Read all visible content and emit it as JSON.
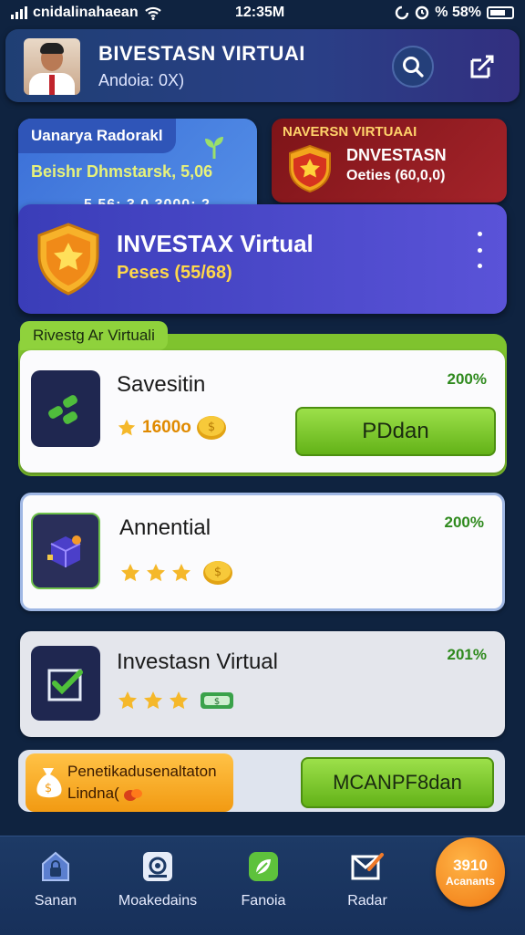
{
  "status": {
    "carrier": "cnidalinahaean",
    "time": "12:35M",
    "battery": "% 58%"
  },
  "header": {
    "title": "BIVESTASN VIRTUAI",
    "subtitle": "Andoia: 0X)"
  },
  "cards": {
    "top_left": {
      "tag": "Uanarya Radorakl",
      "line": "Beishr Dhmstarsk, 5,06",
      "code": "5,56: 3 0,3000: 2"
    },
    "top_right": {
      "title": "NAVERSN VIRTUAAI",
      "name": "DNVESTASN",
      "sub": "Oeties (60,0,0)"
    },
    "main": {
      "title": "INVESTAX Virtual",
      "subtitle": "Peses (55/68)"
    }
  },
  "section": {
    "tag": "Rivestg Ar Virtuali"
  },
  "items": [
    {
      "name": "Savesitin",
      "pct": "200%",
      "amount": "1600o",
      "button": "PDdan"
    },
    {
      "name": "Annential",
      "pct": "200%"
    },
    {
      "name": "Investasn Virtual",
      "pct": "201%"
    }
  ],
  "promo": {
    "line1": "Penetikadusenaltaton",
    "line2": "Lindna(",
    "button": "MCANPF8dan"
  },
  "nav": [
    {
      "label": "Sanan",
      "icon": "home-lock-icon"
    },
    {
      "label": "Moakedains",
      "icon": "camera-icon"
    },
    {
      "label": "Fanoia",
      "icon": "leaf-icon"
    },
    {
      "label": "Radar",
      "icon": "mail-edit-icon"
    }
  ],
  "fab": {
    "line1": "3910",
    "line2": "Acanants"
  },
  "colors": {
    "accent_green": "#7fc32e",
    "brand_blue": "#3a3db8",
    "danger_red": "#a4232a",
    "gold": "#f5b82a"
  }
}
